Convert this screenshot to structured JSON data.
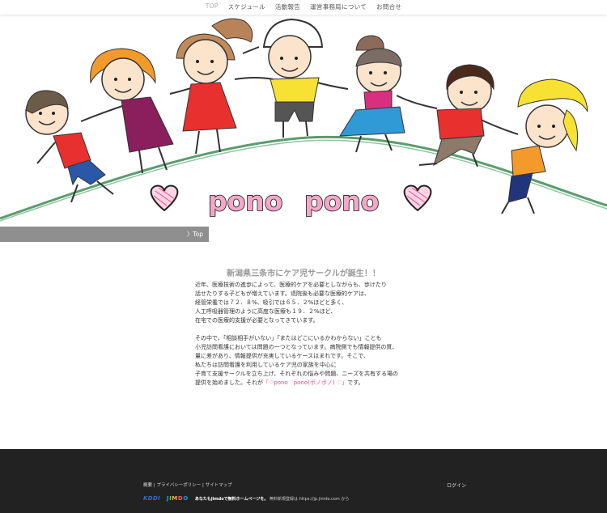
{
  "nav": {
    "items": [
      {
        "label": "TOP",
        "active": true
      },
      {
        "label": "スケジュール",
        "active": false
      },
      {
        "label": "活動報告",
        "active": false
      },
      {
        "label": "運営事務局について",
        "active": false
      },
      {
        "label": "お問合せ",
        "active": false
      }
    ]
  },
  "hero": {
    "logo_word_1": "pono",
    "logo_word_2": "pono"
  },
  "breadcrumb": {
    "label": "〉Top"
  },
  "article": {
    "heading": "新潟県三条市にケア児サークルが誕生！！",
    "paragraph1": [
      "近年、医療技術の進歩によって、医療的ケアを必要としながらも、歩けたり",
      "話せたりする子どもが増えています。退院後も必要な医療的ケアは、",
      "経管栄養では７２．８%、吸引では６５．２%ほどと多く、",
      "人工呼吸器管理のように高度な医療も１９．２%ほど、",
      "在宅での医療的支援が必要となってきています。"
    ],
    "paragraph2": [
      "その中で、「相談相手がいない」「またはどこにいるかわからない」ことも",
      "小児訪問看護においては問題の一つとなっています。病院側でも情報提供の質、",
      "量に差があり、情報提供が充実しているケースはまれです。そこで、",
      "私たちは訪問看護を利用しているケア児の家族を中心に",
      "子育て支援サークルを立ち上げ、それぞれの悩みや問題、ニーズを共有する場の"
    ],
    "last_line_pre": "提供を始めました。それが",
    "last_line_highlight": "「♡pono　pono(ポノポノ) ♡」",
    "last_line_post": "です。"
  },
  "footer": {
    "links": "概要 | プライバシーポリシー | サイトマップ",
    "login": "ログイン",
    "kddi": "KDDI",
    "jimdo_letters": [
      "J",
      "I",
      "M",
      "D",
      "O"
    ],
    "promo_bold": "あなたもJimdoで無料ホームページを。",
    "promo_rest": " 無料新規登録は https://jp.jimdo.com から"
  },
  "colors": {
    "accent_pink": "#e84c8d",
    "footer_bg": "#222222",
    "crumb_bg": "#8f8f8f"
  }
}
